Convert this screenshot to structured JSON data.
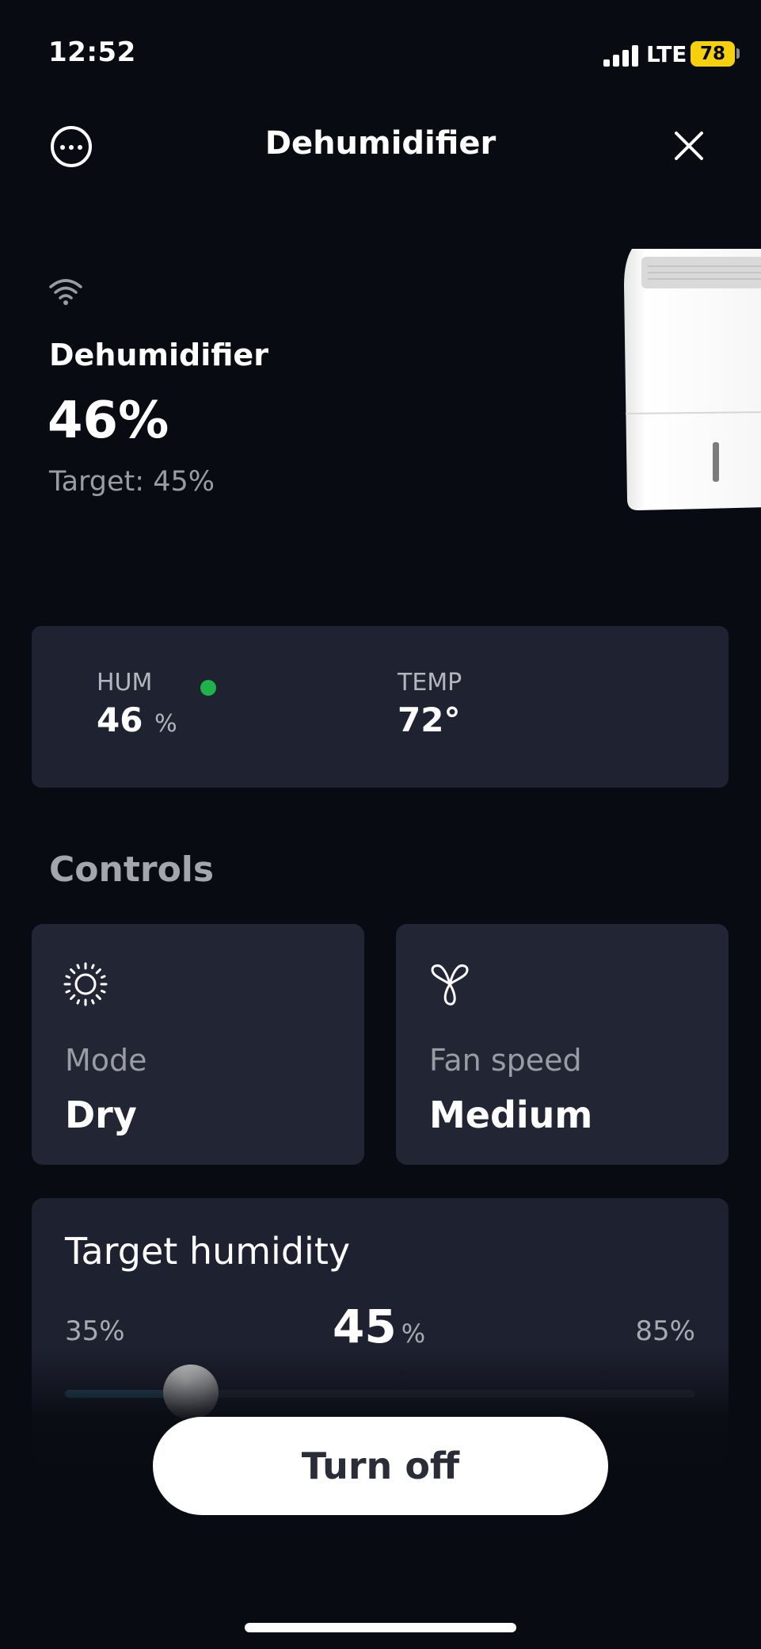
{
  "status_bar": {
    "time": "12:52",
    "network": "LTE",
    "battery": "78"
  },
  "header": {
    "title": "Dehumidifier",
    "more_icon": "ellipsis-circle-icon",
    "close_icon": "close-icon"
  },
  "device": {
    "connection_icon": "wifi-icon",
    "name": "Dehumidifier",
    "humidity": "46%",
    "target_text": "Target: 45%"
  },
  "stats": {
    "humidity_label": "HUM",
    "humidity_value": "46",
    "humidity_unit": "%",
    "humidity_status_color": "#1db34a",
    "temp_label": "TEMP",
    "temp_value": "72°"
  },
  "controls": {
    "heading": "Controls",
    "mode": {
      "icon": "sun-icon",
      "label": "Mode",
      "value": "Dry"
    },
    "fan": {
      "icon": "fan-icon",
      "label": "Fan speed",
      "value": "Medium"
    }
  },
  "target_humidity": {
    "title": "Target humidity",
    "min": "35%",
    "max": "85%",
    "value": "45",
    "unit": "%",
    "slider_min": 35,
    "slider_max": 85,
    "slider_value": 45
  },
  "actions": {
    "turn_off_label": "Turn off"
  }
}
